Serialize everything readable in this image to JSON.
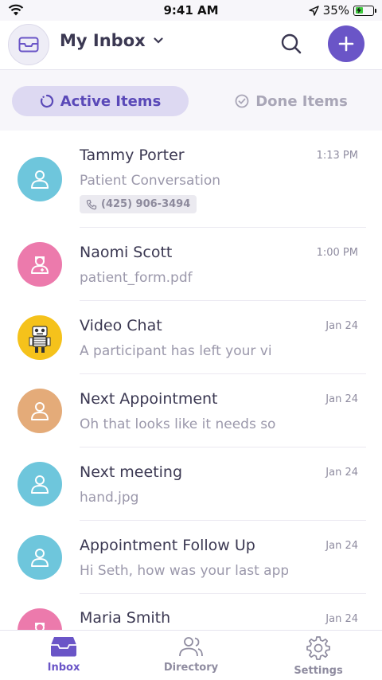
{
  "status_bar": {
    "time": "9:41 AM",
    "battery": "35%"
  },
  "header": {
    "title": "My Inbox"
  },
  "tabs": [
    {
      "label": "Active Items",
      "active": true
    },
    {
      "label": "Done Items",
      "active": false
    }
  ],
  "conversations": [
    {
      "name": "Tammy Porter",
      "subtitle": "Patient Conversation",
      "time": "1:13 PM",
      "phone": "(425) 906-3494",
      "avatar": "person-icon",
      "avatar_color": "#6ec6dc"
    },
    {
      "name": "Naomi Scott",
      "subtitle": "patient_form.pdf",
      "time": "1:00 PM",
      "avatar": "provider-icon",
      "avatar_color": "#ec7aac"
    },
    {
      "name": "Video Chat",
      "subtitle": "A participant has left your vi",
      "time": "Jan 24",
      "avatar": "robot-icon",
      "avatar_color": "#f5c21b"
    },
    {
      "name": "Next Appointment",
      "subtitle": "Oh that looks like it needs so",
      "time": "Jan 24",
      "avatar": "person-icon",
      "avatar_color": "#e4ab79"
    },
    {
      "name": "Next meeting",
      "subtitle": "hand.jpg",
      "time": "Jan 24",
      "avatar": "person-icon",
      "avatar_color": "#6ec6dc"
    },
    {
      "name": "Appointment Follow Up",
      "subtitle": "Hi Seth, how was your last app",
      "time": "Jan 24",
      "avatar": "person-icon",
      "avatar_color": "#6ec6dc"
    },
    {
      "name": "Maria Smith",
      "subtitle": "",
      "time": "Jan 24",
      "avatar": "provider-icon",
      "avatar_color": "#ec7aac"
    }
  ],
  "tab_bar": [
    {
      "label": "Inbox",
      "icon": "inbox-tray-icon",
      "active": true
    },
    {
      "label": "Directory",
      "icon": "people-icon",
      "active": false
    },
    {
      "label": "Settings",
      "icon": "gear-icon",
      "active": false
    }
  ],
  "colors": {
    "accent": "#6a55c7",
    "accent_light": "#ddd9f2"
  }
}
